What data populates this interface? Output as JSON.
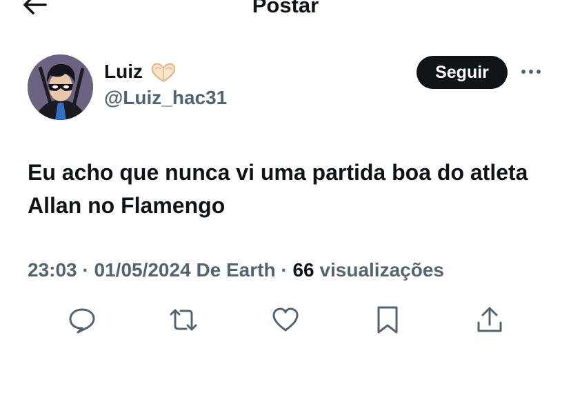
{
  "header": {
    "title": "Postar",
    "back_icon": "arrow-left-icon"
  },
  "author": {
    "display_name": "Luiz",
    "emoji_icon": "heart-hands-icon",
    "handle": "@Luiz_hac31",
    "avatar_icon": "avatar-masked-hero"
  },
  "follow_button": {
    "label": "Seguir"
  },
  "more_icon": "more-horizontal-icon",
  "tweet": {
    "text": "Eu acho que nunca vi uma partida boa do atleta Allan no Flamengo"
  },
  "meta": {
    "time": "23:03",
    "separator": " · ",
    "date": "01/05/2024",
    "source": "De Earth",
    "views_count": "66",
    "views_label": "visualizações"
  },
  "actions": [
    {
      "name": "reply",
      "icon": "reply-icon"
    },
    {
      "name": "repost",
      "icon": "repost-icon"
    },
    {
      "name": "like",
      "icon": "heart-icon"
    },
    {
      "name": "bookmark",
      "icon": "bookmark-icon"
    },
    {
      "name": "share",
      "icon": "share-icon"
    }
  ],
  "colors": {
    "text_primary": "#0f1419",
    "text_secondary": "#536471",
    "follow_bg": "#0f1419",
    "follow_text": "#ffffff"
  }
}
